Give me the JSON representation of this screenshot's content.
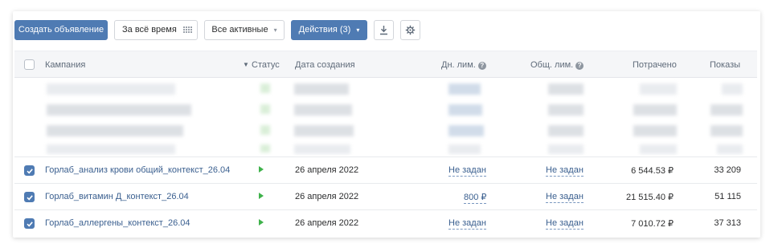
{
  "toolbar": {
    "create_label": "Создать объявление",
    "period_label": "За всё время",
    "filter_label": "Все активные",
    "actions_label": "Действия (3)"
  },
  "table": {
    "columns": {
      "campaign": "Кампания",
      "status": "Статус",
      "created": "Дата создания",
      "daily_limit": "Дн. лим.",
      "total_limit": "Общ. лим.",
      "spent": "Потрачено",
      "impressions": "Показы"
    },
    "rows": [
      {
        "name": "Горлаб_анализ крови общий_контекст_26.04",
        "date": "26 апреля 2022",
        "daily": "Не задан",
        "total": "Не задан",
        "spent": "6 544.53 ₽",
        "shows": "33 209"
      },
      {
        "name": "Горлаб_витамин Д_контекст_26.04",
        "date": "26 апреля 2022",
        "daily": "800 ₽",
        "total": "Не задан",
        "spent": "21 515.40 ₽",
        "shows": "51 115"
      },
      {
        "name": "Горлаб_аллергены_контекст_26.04",
        "date": "26 апреля 2022",
        "daily": "Не задан",
        "total": "Не задан",
        "spent": "7 010.72 ₽",
        "shows": "37 313"
      }
    ]
  },
  "colors": {
    "primary": "#4f7bb3",
    "link": "#3a5f8f",
    "status_active": "#3fb24b"
  }
}
